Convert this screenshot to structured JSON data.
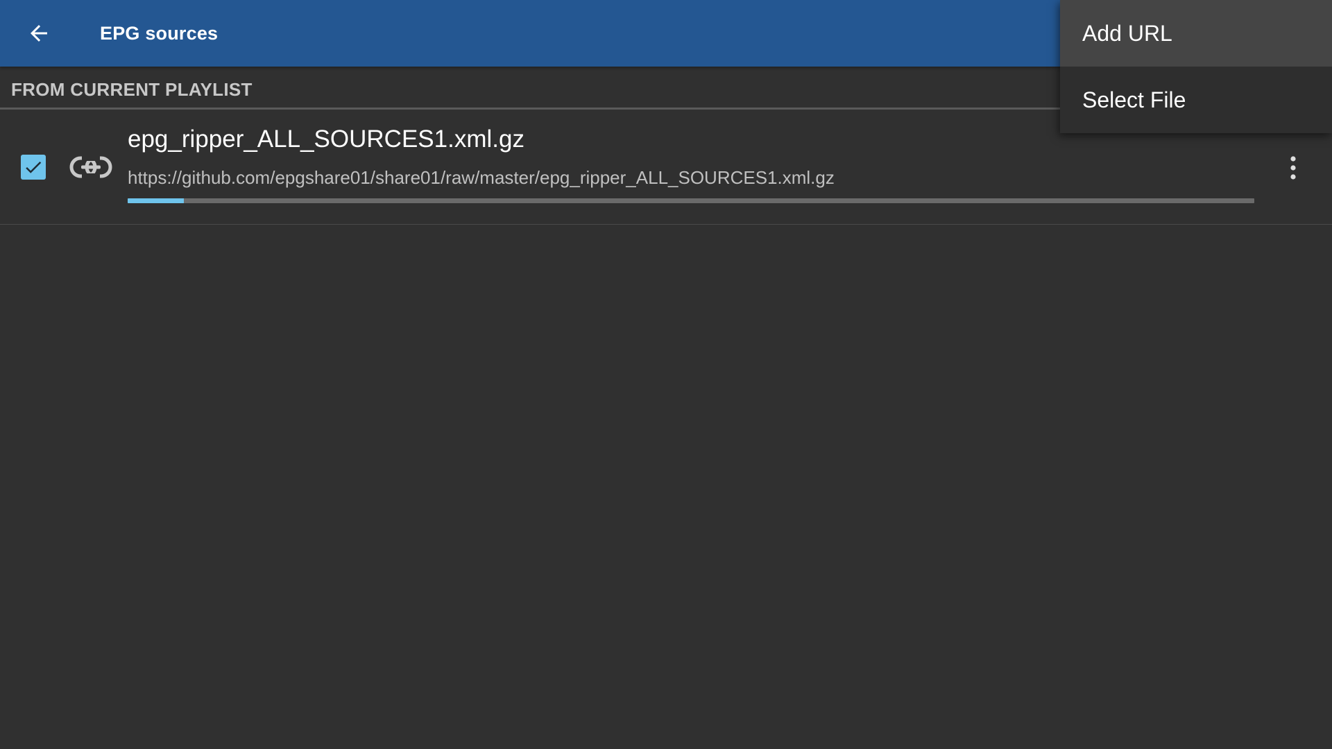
{
  "appbar": {
    "title": "EPG sources",
    "back_icon": "arrow-left-icon",
    "color": "#245792"
  },
  "section": {
    "title": "FROM CURRENT PLAYLIST"
  },
  "sources": [
    {
      "name": "epg_ripper_ALL_SOURCES1.xml.gz",
      "url": "https://github.com/epgshare01/share01/raw/master/epg_ripper_ALL_SOURCES1.xml.gz",
      "checked": true,
      "type_icon": "link-icon",
      "progress_fraction": 0.05,
      "menu_icon": "more-vertical-icon"
    }
  ],
  "menu": {
    "items": [
      {
        "label": "Add URL",
        "focused": true
      },
      {
        "label": "Select File",
        "focused": false
      }
    ]
  },
  "colors": {
    "background": "#303030",
    "accent": "#6fc4ec",
    "menu_background": "#2e2e2e",
    "menu_focus": "#454545"
  }
}
